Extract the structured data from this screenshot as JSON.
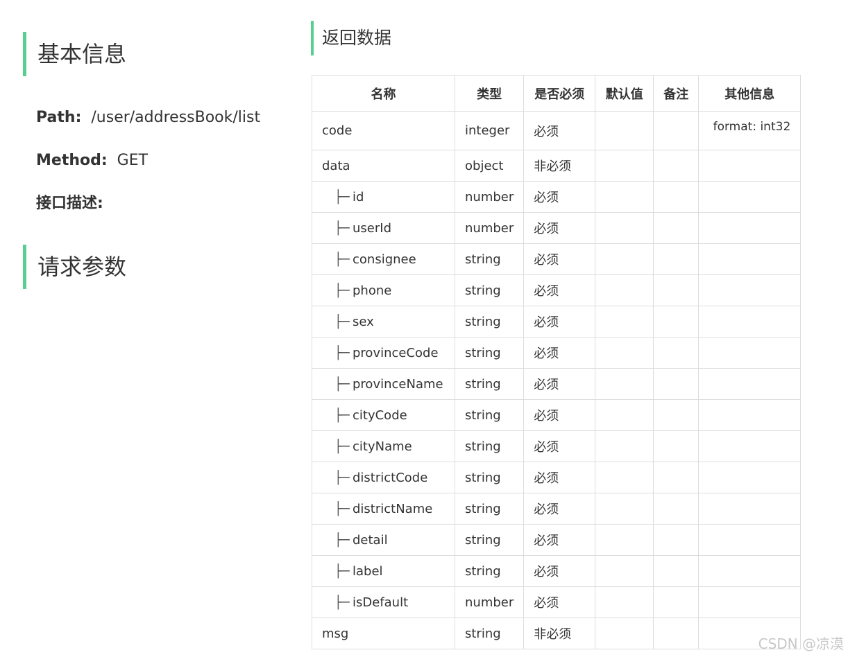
{
  "basic": {
    "title": "基本信息",
    "path_label": "Path",
    "path_value": "/user/addressBook/list",
    "method_label": "Method",
    "method_value": "GET",
    "desc_label": "接口描述",
    "colon": ":"
  },
  "request": {
    "title": "请求参数"
  },
  "response": {
    "title": "返回数据",
    "headers": [
      "名称",
      "类型",
      "是否必须",
      "默认值",
      "备注",
      "其他信息"
    ],
    "child_prefix": "├─",
    "rows": [
      {
        "name": "code",
        "type": "integer",
        "required": "必须",
        "default": "",
        "note": "",
        "other": "format: int32",
        "child": false
      },
      {
        "name": "data",
        "type": "object",
        "required": "非必须",
        "default": "",
        "note": "",
        "other": "",
        "child": false
      },
      {
        "name": "id",
        "type": "number",
        "required": "必须",
        "default": "",
        "note": "",
        "other": "",
        "child": true
      },
      {
        "name": "userId",
        "type": "number",
        "required": "必须",
        "default": "",
        "note": "",
        "other": "",
        "child": true
      },
      {
        "name": "consignee",
        "type": "string",
        "required": "必须",
        "default": "",
        "note": "",
        "other": "",
        "child": true
      },
      {
        "name": "phone",
        "type": "string",
        "required": "必须",
        "default": "",
        "note": "",
        "other": "",
        "child": true
      },
      {
        "name": "sex",
        "type": "string",
        "required": "必须",
        "default": "",
        "note": "",
        "other": "",
        "child": true
      },
      {
        "name": "provinceCode",
        "type": "string",
        "required": "必须",
        "default": "",
        "note": "",
        "other": "",
        "child": true
      },
      {
        "name": "provinceName",
        "type": "string",
        "required": "必须",
        "default": "",
        "note": "",
        "other": "",
        "child": true
      },
      {
        "name": "cityCode",
        "type": "string",
        "required": "必须",
        "default": "",
        "note": "",
        "other": "",
        "child": true
      },
      {
        "name": "cityName",
        "type": "string",
        "required": "必须",
        "default": "",
        "note": "",
        "other": "",
        "child": true
      },
      {
        "name": "districtCode",
        "type": "string",
        "required": "必须",
        "default": "",
        "note": "",
        "other": "",
        "child": true
      },
      {
        "name": "districtName",
        "type": "string",
        "required": "必须",
        "default": "",
        "note": "",
        "other": "",
        "child": true
      },
      {
        "name": "detail",
        "type": "string",
        "required": "必须",
        "default": "",
        "note": "",
        "other": "",
        "child": true
      },
      {
        "name": "label",
        "type": "string",
        "required": "必须",
        "default": "",
        "note": "",
        "other": "",
        "child": true
      },
      {
        "name": "isDefault",
        "type": "number",
        "required": "必须",
        "default": "",
        "note": "",
        "other": "",
        "child": true
      },
      {
        "name": "msg",
        "type": "string",
        "required": "非必须",
        "default": "",
        "note": "",
        "other": "",
        "child": false
      }
    ]
  },
  "watermark": "CSDN @凉漠",
  "colors": {
    "accent": "#56cf8f",
    "text": "#333333",
    "border": "#dddddd"
  }
}
